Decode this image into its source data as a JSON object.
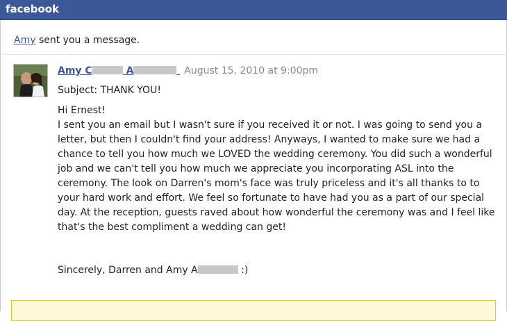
{
  "app": {
    "brand": "facebook"
  },
  "notification": {
    "sender_link": "Amy",
    "text": "sent you a message."
  },
  "message": {
    "author_first": "Amy C",
    "author_last_initial": "A",
    "timestamp": "August 15, 2010 at 9:00pm",
    "subject": "Subject: THANK YOU!",
    "greeting": "Hi Ernest!",
    "body": "I sent you an email but I wasn't sure if you received it or not. I was going to send you a letter, but then I couldn't find your address! Anyways, I wanted to make sure we had a chance to tell you how much we LOVED the wedding ceremony. You did such a wonderful job and we can't tell you how much we appreciate you incorporating ASL into the ceremony. The look on Darren's mom's face was truly priceless and it's all thanks to to your hard work and effort. We feel so fortunate to have had you as a part of our special day. At the reception, guests raved about how wonderful the ceremony was and I feel like that's the best compliment a wedding can get!",
    "signoff_prefix": "Sincerely, Darren and Amy A",
    "signoff_suffix": ":)"
  },
  "colors": {
    "brand_bar": "#3b5998",
    "link": "#3b5998",
    "timestamp": "#888888",
    "notice_bg": "#fff9d7",
    "notice_border": "#e2c822"
  },
  "icons": {
    "avatar": "profile-photo"
  }
}
